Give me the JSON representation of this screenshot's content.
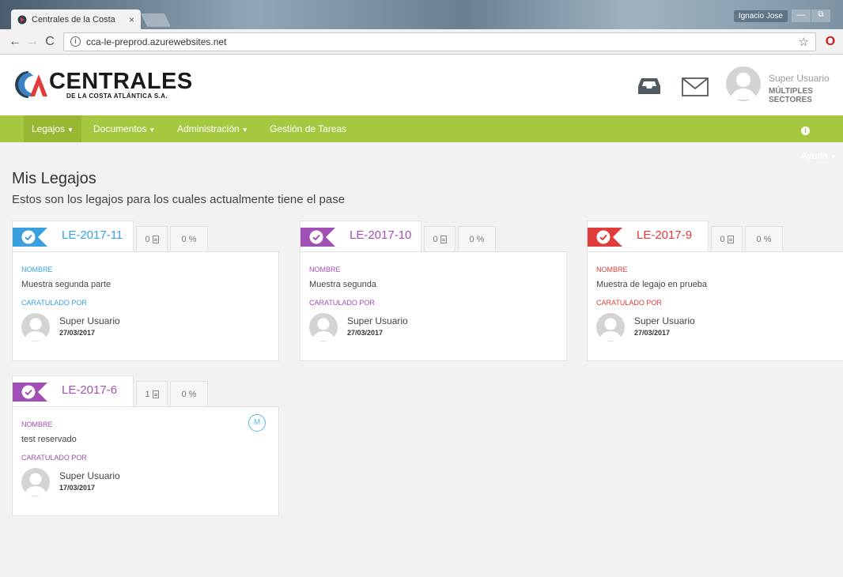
{
  "browser": {
    "tab_title": "Centrales de la Costa",
    "tab_close": "×",
    "url": "cca-le-preprod.azurewebsites.net",
    "os_user": "Ignacio Jose",
    "win_min": "—",
    "win_max": "⧉"
  },
  "header": {
    "logo_main": "CENTRALES",
    "logo_sub": "DE LA COSTA ATLÁNTICA S.A.",
    "user_name": "Super Usuario",
    "user_sector": "MÚLTIPLES SECTORES"
  },
  "nav": {
    "items": [
      {
        "label": "Legajos"
      },
      {
        "label": "Documentos"
      },
      {
        "label": "Administración"
      },
      {
        "label": "Gestión de Tareas"
      }
    ],
    "help": "Ayuda"
  },
  "page": {
    "title": "Mis Legajos",
    "subtitle": "Estos son los legajos para los cuales actualmente tiene el pase"
  },
  "labels": {
    "nombre": "NOMBRE",
    "caratulado_por": "CARATULADO POR"
  },
  "colors": {
    "blue": "#3aa0dd",
    "purple": "#a050b4",
    "red": "#e03c3c",
    "nav_green": "#a6c740"
  },
  "cards": [
    {
      "code": "LE-2017-11",
      "color": "blue",
      "docs": "0",
      "percent": "0",
      "name": "Muestra segunda parte",
      "person": "Super Usuario",
      "date": "27/03/2017"
    },
    {
      "code": "LE-2017-10",
      "color": "purple",
      "docs": "0",
      "percent": "0",
      "name": "Muestra segunda",
      "person": "Super Usuario",
      "date": "27/03/2017"
    },
    {
      "code": "LE-2017-9",
      "color": "red",
      "docs": "0",
      "percent": "0",
      "name": "Muestra de legajo en prueba",
      "person": "Super Usuario",
      "date": "27/03/2017"
    },
    {
      "code": "LE-2017-6",
      "color": "purple",
      "docs": "1",
      "percent": "0",
      "name": "test reservado",
      "person": "Super Usuario",
      "date": "17/03/2017",
      "badge": "M"
    }
  ]
}
